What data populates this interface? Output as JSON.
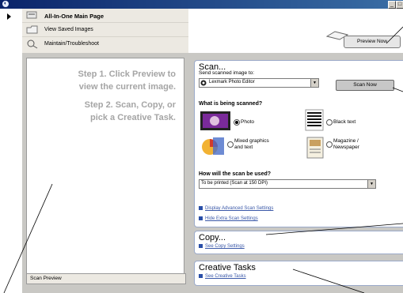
{
  "nav": {
    "items": [
      {
        "label": "All-In-One Main Page",
        "icon": "all-in-one-icon"
      },
      {
        "label": "View Saved Images",
        "icon": "folder-icon"
      },
      {
        "label": "Maintain/Troubleshoot",
        "icon": "maintain-icon"
      }
    ]
  },
  "preview": {
    "step1_line1": "Step 1.  Click Preview to",
    "step1_line2": "view the current image.",
    "step2_line1": "Step 2.  Scan, Copy, or",
    "step2_line2": "pick a Creative Task.",
    "label": "Scan Preview",
    "button": "Preview Now"
  },
  "scan": {
    "title": "Scan...",
    "send_to_label": "Send scanned image to:",
    "send_to_value": "Lexmark Photo Editor",
    "scan_button": "Scan Now",
    "what_label": "What is being scanned?",
    "options": [
      "Photo",
      "Black text",
      "Mixed graphics",
      "and text",
      "Magazine /",
      "Newspaper"
    ],
    "selected": "Photo",
    "use_label": "How will the scan be used?",
    "use_value": "To be printed (Scan at 150 DPI)",
    "link_advanced": "Display Advanced Scan Settings",
    "link_hide_extra": "Hide Extra Scan Settings"
  },
  "copy": {
    "title": "Copy...",
    "link": "See Copy Settings"
  },
  "creative": {
    "title": "Creative Tasks",
    "link": "See Creative Tasks"
  },
  "colors": {
    "titlebar": "#0a246a",
    "link": "#3a58a8",
    "panel": "#c9c8c4"
  }
}
